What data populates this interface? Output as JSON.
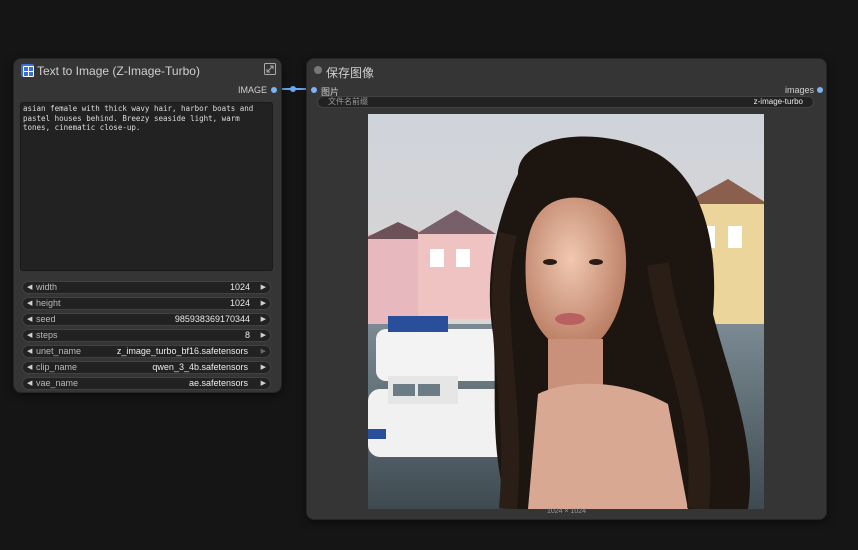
{
  "text_node": {
    "title": "Text to Image (Z-Image-Turbo)",
    "output_label": "IMAGE",
    "prompt": "asian female with thick wavy hair, harbor boats and pastel houses behind. Breezy seaside light, warm tones, cinematic close-up.",
    "widgets": [
      {
        "name": "width",
        "value": "1024"
      },
      {
        "name": "height",
        "value": "1024"
      },
      {
        "name": "seed",
        "value": "985938369170344"
      },
      {
        "name": "steps",
        "value": "8"
      },
      {
        "name": "unet_name",
        "value": "z_image_turbo_bf16.safetensors"
      },
      {
        "name": "clip_name",
        "value": "qwen_3_4b.safetensors"
      },
      {
        "name": "vae_name",
        "value": "ae.safetensors"
      }
    ]
  },
  "save_node": {
    "title": "保存图像",
    "input_label": "图片",
    "output_label": "images",
    "filename_prefix_label": "文件名前缀",
    "filename_prefix_value": "z-image-turbo",
    "image_dimensions": "1024 × 1024"
  },
  "colors": {
    "canvas": "#151515",
    "node_bg": "#353535",
    "slot": "#7fb2f0",
    "link": "#6aa8ef",
    "logo": "#3b6fd8"
  }
}
